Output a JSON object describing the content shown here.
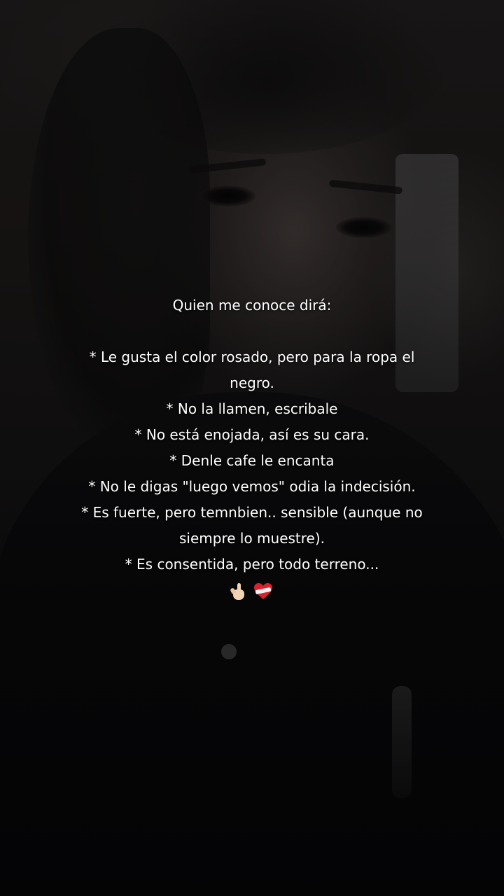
{
  "caption": {
    "title": "Quien me conoce dirá:",
    "items": [
      "* Le gusta el color rosado, pero para la ropa el",
      "negro.",
      "* No la llamen, escribale",
      "* No está enojada, así es su cara.",
      "* Denle cafe le encanta",
      "* No le digas \"luego vemos\" odia la indecisión.",
      "* Es fuerte, pero temnbien.. sensible (aunque no",
      "siempre lo muestre).",
      "* Es consentida, pero todo terreno..."
    ],
    "emojis": [
      "hand-with-index-finger-and-thumb-crossed-icon",
      "mending-heart-icon"
    ]
  },
  "colors": {
    "text": "#ffffff",
    "heart": "#d8232f",
    "bandage": "#f2f2f2",
    "skin": "#f1d3b6"
  }
}
